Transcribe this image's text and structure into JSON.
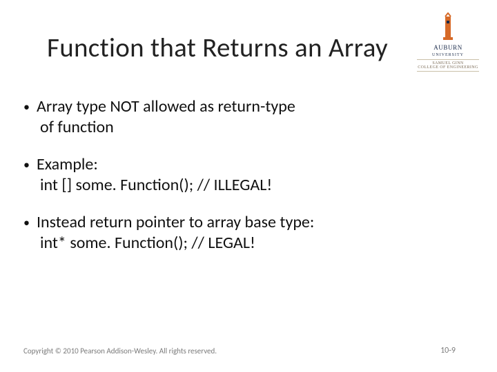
{
  "logo": {
    "name": "AUBURN",
    "sub1": "UNIVERSITY",
    "sub2": "SAMUEL GINN",
    "sub3": "COLLEGE OF ENGINEERING"
  },
  "title": "Function that Returns an Array",
  "bullets": [
    {
      "lead": "Array type NOT allowed as return-type",
      "cont": "of function"
    },
    {
      "lead": "Example:",
      "cont": "int [] some. Function();   // ILLEGAL!"
    },
    {
      "lead": "Instead return pointer to array base type:",
      "cont": "int* some. Function();  // LEGAL!"
    }
  ],
  "footer": {
    "copyright": "Copyright © 2010 Pearson Addison-Wesley. All rights reserved.",
    "slidenum": "10-9"
  }
}
